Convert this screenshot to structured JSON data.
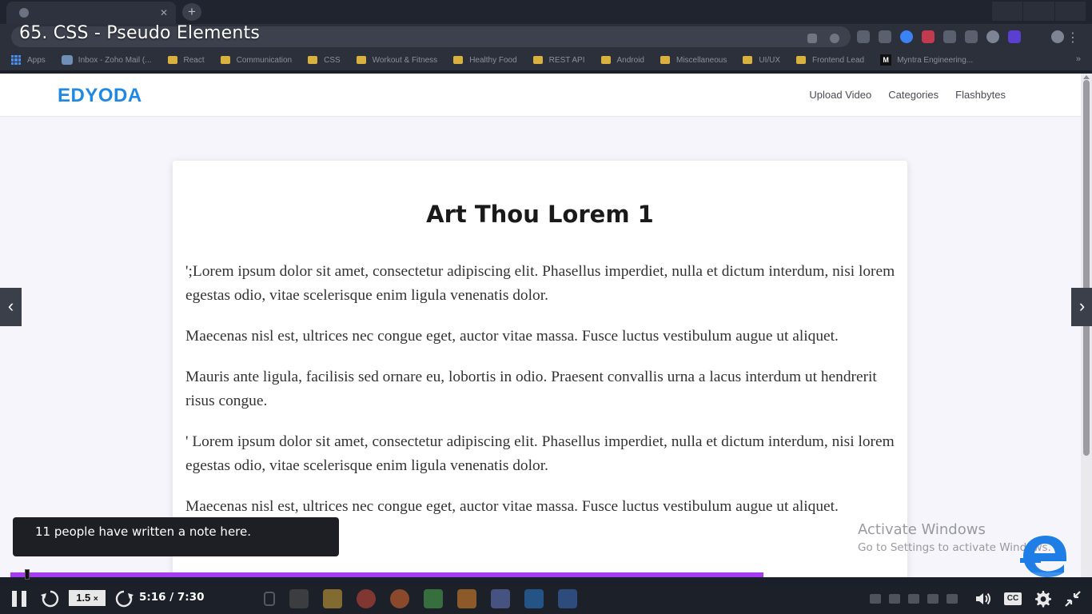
{
  "player": {
    "video_title": "65. CSS - Pseudo Elements",
    "current_time": "5:16",
    "duration": "7:30",
    "time_display": "5:16 / 7:30",
    "speed_value": "1.5",
    "speed_suffix": "×",
    "progress_fraction": 0.703,
    "note_popup": "11 people have written a note here.",
    "cc_label": "CC",
    "colors": {
      "progress": "#a43cf0",
      "control_bar": "#1c2028"
    }
  },
  "browser": {
    "bookmarks": [
      {
        "label": "Apps",
        "icon": "apps-grid-icon"
      },
      {
        "label": "Inbox - Zoho Mail (...",
        "icon": "mail-icon"
      },
      {
        "label": "React",
        "icon": "folder-icon"
      },
      {
        "label": "Communication",
        "icon": "folder-icon"
      },
      {
        "label": "CSS",
        "icon": "folder-icon"
      },
      {
        "label": "Workout & Fitness",
        "icon": "folder-icon"
      },
      {
        "label": "Healthy Food",
        "icon": "folder-icon"
      },
      {
        "label": "REST API",
        "icon": "folder-icon"
      },
      {
        "label": "Android",
        "icon": "folder-icon"
      },
      {
        "label": "Miscellaneous",
        "icon": "folder-icon"
      },
      {
        "label": "UI/UX",
        "icon": "folder-icon"
      },
      {
        "label": "Frontend Lead",
        "icon": "folder-icon"
      },
      {
        "label": "Myntra Engineering...",
        "icon": "medium-icon"
      }
    ],
    "more_label": "»"
  },
  "site": {
    "logo": "EDYODA",
    "nav": [
      "Upload Video",
      "Categories",
      "Flashbytes"
    ],
    "colors": {
      "logo": "#1e88e5"
    },
    "card": {
      "title": "Art Thou Lorem 1",
      "paragraphs": [
        "';Lorem ipsum dolor sit amet, consectetur adipiscing elit. Phasellus imperdiet, nulla et dictum interdum, nisi lorem egestas odio, vitae scelerisque enim ligula venenatis dolor.",
        "Maecenas nisl est, ultrices nec congue eget, auctor vitae massa. Fusce luctus vestibulum augue ut aliquet.",
        "Mauris ante ligula, facilisis sed ornare eu, lobortis in odio. Praesent convallis urna a lacus interdum ut hendrerit risus congue.",
        "' Lorem ipsum dolor sit amet, consectetur adipiscing elit. Phasellus imperdiet, nulla et dictum interdum, nisi lorem egestas odio, vitae scelerisque enim ligula venenatis dolor.",
        "Maecenas nisl est, ultrices nec congue eget, auctor vitae massa. Fusce luctus vestibulum augue ut aliquet."
      ]
    }
  },
  "os": {
    "activate_line1": "Activate Windows",
    "activate_line2": "Go to Settings to activate Windows."
  }
}
